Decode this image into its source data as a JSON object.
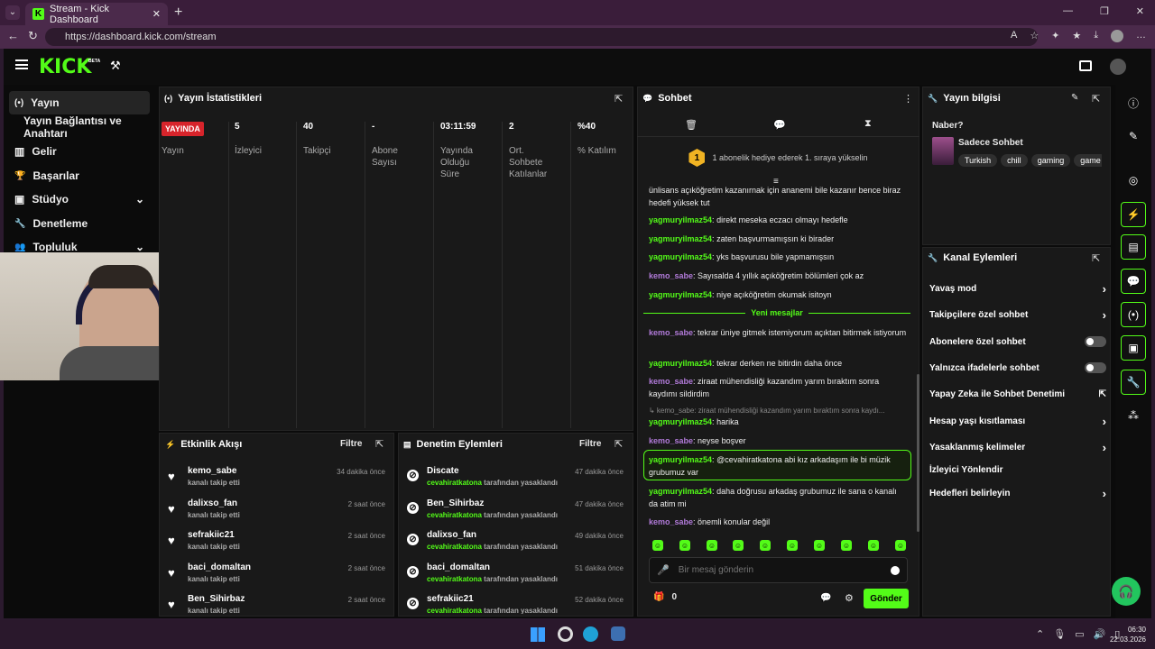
{
  "browser": {
    "tab_title": "Stream - Kick Dashboard",
    "url": "https://dashboard.kick.com/stream"
  },
  "app": {
    "logo": "KICK",
    "beta": "BETA"
  },
  "sidebar": {
    "items": [
      {
        "label": "Yayın",
        "icon": "(•)"
      },
      {
        "label": "Yayın Bağlantısı ve Anahtarı",
        "icon": ""
      },
      {
        "label": "Gelir",
        "icon": "▥"
      },
      {
        "label": "Başarılar",
        "icon": "🏆"
      },
      {
        "label": "Stüdyo",
        "icon": "▣"
      },
      {
        "label": "Denetleme",
        "icon": "🔧"
      },
      {
        "label": "Topluluk",
        "icon": "👥"
      }
    ]
  },
  "stats": {
    "title": "Yayın İstatistikleri",
    "live_badge": "YAYINDA",
    "cols": [
      {
        "value": "",
        "label": "Yayın"
      },
      {
        "value": "5",
        "label": "İzleyici"
      },
      {
        "value": "40",
        "label": "Takipçi"
      },
      {
        "value": "-",
        "label": "Abone Sayısı"
      },
      {
        "value": "03:11:59",
        "label": "Yayında Olduğu Süre"
      },
      {
        "value": "2",
        "label": "Ort. Sohbete Katılanlar"
      },
      {
        "value": "%40",
        "label": "% Katılım"
      }
    ]
  },
  "events": {
    "title": "Etkinlik Akışı",
    "filter": "Filtre",
    "rows": [
      {
        "name": "kemo_sabe",
        "sub": "kanalı takip etti",
        "time": "34 dakika önce"
      },
      {
        "name": "dalixso_fan",
        "sub": "kanalı takip etti",
        "time": "2 saat önce"
      },
      {
        "name": "sefrakiic21",
        "sub": "kanalı takip etti",
        "time": "2 saat önce"
      },
      {
        "name": "baci_domaltan",
        "sub": "kanalı takip etti",
        "time": "2 saat önce"
      },
      {
        "name": "Ben_Sihirbaz",
        "sub": "kanalı takip etti",
        "time": "2 saat önce"
      }
    ]
  },
  "modlog": {
    "title": "Denetim Eylemleri",
    "filter": "Filtre",
    "by": "cevahiratkatona",
    "suffix": "tarafından yasaklandı",
    "rows": [
      {
        "name": "Discate",
        "time": "47 dakika önce"
      },
      {
        "name": "Ben_Sihirbaz",
        "time": "47 dakika önce"
      },
      {
        "name": "dalixso_fan",
        "time": "49 dakika önce"
      },
      {
        "name": "baci_domaltan",
        "time": "51 dakika önce"
      },
      {
        "name": "sefrakiic21",
        "time": "52 dakika önce"
      }
    ]
  },
  "chat": {
    "title": "Sohbet",
    "gift_badge": "1",
    "gift_text": "1 abonelik hediye ederek 1. sıraya yükselin",
    "new_messages": "Yeni mesajlar",
    "top_partial": "ünlisans açıköğretim kazanırnak için ananemi bile kazanır bence biraz hedefi yüksek tut",
    "messages": [
      {
        "user": "yagmuryilmaz54",
        "text": "direkt meseka eczacı olmayı hedefle"
      },
      {
        "user": "yagmuryilmaz54",
        "text": "zaten başvurmamışsın ki birader"
      },
      {
        "user": "yagmuryilmaz54",
        "text": "yks başvurusu bile yapmamışsın"
      },
      {
        "user": "kemo_sabe",
        "text": "Sayısalda 4 yıllık açıköğretim bölümleri çok az"
      },
      {
        "user": "yagmuryilmaz54",
        "text": "niye açıköğretim okumak isitoyn"
      },
      {
        "user": "kemo_sabe",
        "text": "tekrar üniye gitmek istemiyorum açıktan bitirmek istiyorum"
      },
      {
        "user": "yagmuryilmaz54",
        "text": "tekrar derken ne bitirdin daha önce"
      },
      {
        "user": "kemo_sabe",
        "text": "ziraat mühendisliği kazandım yarım bıraktım sonra kaydımı sildirdim"
      },
      {
        "user": "yagmuryilmaz54",
        "text": "harika"
      },
      {
        "user": "kemo_sabe",
        "text": "neyse boşver"
      },
      {
        "user": "yagmuryilmaz54",
        "text": "@cevahiratkatona abi kız arkadaşım ile bi müzik grubumuz var",
        "mention": "@cevahiratkatona"
      },
      {
        "user": "yagmuryilmaz54",
        "text": "daha doğrusu arkadaş grubumuz ile sana o kanalı da atim mi"
      },
      {
        "user": "kemo_sabe",
        "text": "önemli konular değil"
      }
    ],
    "reply_preview": "↳ kemo_sabe: ziraat mühendisliği kazandım yarım bıraktım sonra kaydı...",
    "input_placeholder": "Bir mesaj gönderin",
    "points": "0",
    "send": "Gönder"
  },
  "streaminfo": {
    "title": "Yayın bilgisi",
    "question": "Naber?",
    "category": "Sadece Sohbet",
    "tags": [
      "Turkish",
      "chill",
      "gaming",
      "game"
    ]
  },
  "channel_actions": {
    "title": "Kanal Eylemleri",
    "items": [
      {
        "label": "Yavaş mod",
        "control": "arrow"
      },
      {
        "label": "Takipçilere özel sohbet",
        "control": "arrow"
      },
      {
        "label": "Abonelere özel sohbet",
        "control": "toggle"
      },
      {
        "label": "Yalnızca ifadelerle sohbet",
        "control": "toggle"
      },
      {
        "label": "Yapay Zeka ile Sohbet Denetimi",
        "control": "external"
      },
      {
        "label": "Hesap yaşı kısıtlaması",
        "control": "arrow"
      },
      {
        "label": "Yasaklanmış kelimeler",
        "control": "arrow"
      },
      {
        "label": "İzleyici Yönlendir",
        "control": "none"
      },
      {
        "label": "Hedefleri belirleyin",
        "control": "arrow"
      }
    ]
  },
  "taskbar": {
    "time": "06:30",
    "date": "22.03.2026"
  },
  "colors": {
    "accent": "#53fc18",
    "live": "#d7242b",
    "mod_username": "#b17ad9"
  }
}
